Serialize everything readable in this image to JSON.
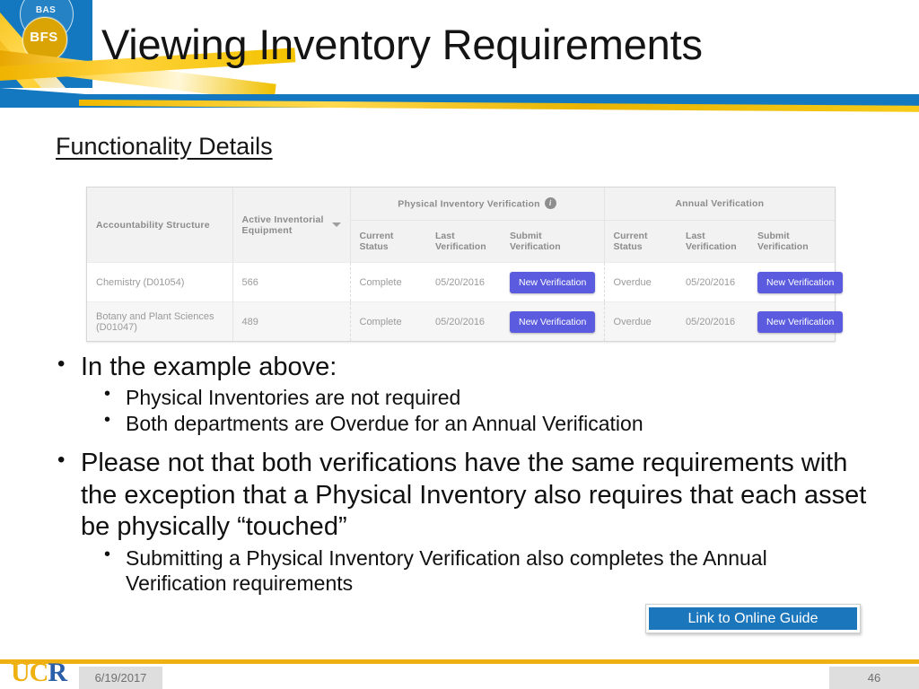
{
  "header": {
    "title": "Viewing Inventory Requirements",
    "logo": {
      "outer_label": "BAS",
      "inner_label": "BFS"
    },
    "accent_blue": "#1378bf",
    "accent_gold": "#f0c000"
  },
  "section": {
    "heading": "Functionality Details"
  },
  "table": {
    "group_headers": {
      "accountability": "Accountability Structure",
      "equipment": "Active Inventorial Equipment",
      "physical": "Physical Inventory Verification",
      "annual": "Annual Verification"
    },
    "sub_headers": {
      "current_status": "Current Status",
      "last_verification": "Last Verification",
      "submit_verification": "Submit Verification"
    },
    "rows": [
      {
        "structure": "Chemistry (D01054)",
        "equipment": "566",
        "physical_status": "Complete",
        "physical_last": "05/20/2016",
        "physical_button": "New Verification",
        "annual_status": "Overdue",
        "annual_last": "05/20/2016",
        "annual_button": "New Verification"
      },
      {
        "structure": "Botany and Plant Sciences (D01047)",
        "equipment": "489",
        "physical_status": "Complete",
        "physical_last": "05/20/2016",
        "physical_button": "New Verification",
        "annual_status": "Overdue",
        "annual_last": "05/20/2016",
        "annual_button": "New Verification"
      }
    ],
    "status_colors": {
      "complete": "#5ed39a",
      "overdue": "#f0737c"
    },
    "button_color": "#5b5be0",
    "info_icon_char": "i"
  },
  "bullets": {
    "l1_a": "In the example above:",
    "l2_a": "Physical Inventories are not required",
    "l2_b": "Both departments are Overdue for an Annual Verification",
    "l1_b": "Please not that both verifications have the same requirements with the exception that a Physical Inventory also requires that each asset be physically “touched”",
    "l2_c": "Submitting a Physical Inventory Verification also completes the Annual Verification requirements"
  },
  "link_button": {
    "label": "Link to Online Guide",
    "color": "#1c76bc"
  },
  "footer": {
    "logo_uc": "UC",
    "logo_r": "R",
    "date": "6/19/2017",
    "page_number": "46"
  }
}
